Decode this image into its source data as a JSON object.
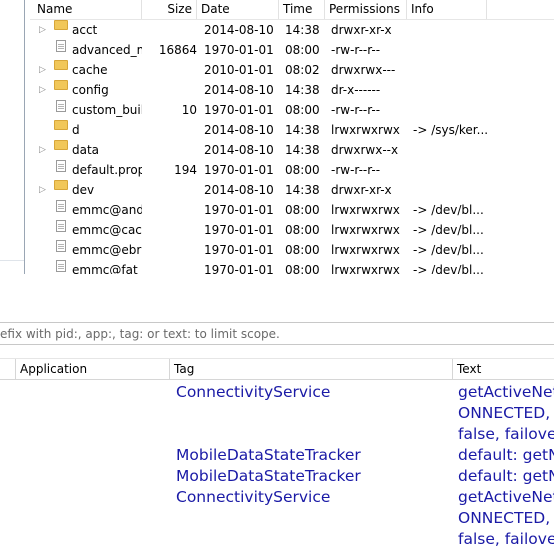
{
  "file_table": {
    "columns": [
      "Name",
      "Size",
      "Date",
      "Time",
      "Permissions",
      "Info"
    ],
    "rows": [
      {
        "name": "acct",
        "type": "folder",
        "expandable": true,
        "size": "",
        "date": "2014-08-10",
        "time": "14:38",
        "permissions": "drwxr-xr-x",
        "info": ""
      },
      {
        "name": "advanced_m",
        "type": "file",
        "expandable": false,
        "size": "16864",
        "date": "1970-01-01",
        "time": "08:00",
        "permissions": "-rw-r--r--",
        "info": ""
      },
      {
        "name": "cache",
        "type": "folder",
        "expandable": true,
        "size": "",
        "date": "2010-01-01",
        "time": "08:02",
        "permissions": "drwxrwx---",
        "info": ""
      },
      {
        "name": "config",
        "type": "folder",
        "expandable": true,
        "size": "",
        "date": "2014-08-10",
        "time": "14:38",
        "permissions": "dr-x------",
        "info": ""
      },
      {
        "name": "custom_buil",
        "type": "file",
        "expandable": false,
        "size": "10",
        "date": "1970-01-01",
        "time": "08:00",
        "permissions": "-rw-r--r--",
        "info": ""
      },
      {
        "name": "d",
        "type": "folder",
        "expandable": false,
        "size": "",
        "date": "2014-08-10",
        "time": "14:38",
        "permissions": "lrwxrwxrwx",
        "info": "-> /sys/ker..."
      },
      {
        "name": "data",
        "type": "folder",
        "expandable": true,
        "size": "",
        "date": "2014-08-10",
        "time": "14:38",
        "permissions": "drwxrwx--x",
        "info": ""
      },
      {
        "name": "default.prop",
        "type": "file",
        "expandable": false,
        "size": "194",
        "date": "1970-01-01",
        "time": "08:00",
        "permissions": "-rw-r--r--",
        "info": ""
      },
      {
        "name": "dev",
        "type": "folder",
        "expandable": true,
        "size": "",
        "date": "2014-08-10",
        "time": "14:38",
        "permissions": "drwxr-xr-x",
        "info": ""
      },
      {
        "name": "emmc@and",
        "type": "file",
        "expandable": false,
        "size": "",
        "date": "1970-01-01",
        "time": "08:00",
        "permissions": "lrwxrwxrwx",
        "info": "-> /dev/bl..."
      },
      {
        "name": "emmc@cacl",
        "type": "file",
        "expandable": false,
        "size": "",
        "date": "1970-01-01",
        "time": "08:00",
        "permissions": "lrwxrwxrwx",
        "info": "-> /dev/bl..."
      },
      {
        "name": "emmc@ebr",
        "type": "file",
        "expandable": false,
        "size": "",
        "date": "1970-01-01",
        "time": "08:00",
        "permissions": "lrwxrwxrwx",
        "info": "-> /dev/bl..."
      },
      {
        "name": "emmc@fat",
        "type": "file",
        "expandable": false,
        "size": "",
        "date": "1970-01-01",
        "time": "08:00",
        "permissions": "lrwxrwxrwx",
        "info": "-> /dev/bl..."
      }
    ]
  },
  "logcat": {
    "filter_hint": "efix with pid:, app:, tag: or text: to limit scope.",
    "columns": [
      "Application",
      "Tag",
      "Text"
    ],
    "lines": [
      {
        "tag": "ConnectivityService",
        "text": "getActiveNet"
      },
      {
        "tag": "",
        "text": "ONNECTED,"
      },
      {
        "tag": "",
        "text": " false, failove"
      },
      {
        "tag": "MobileDataStateTracker",
        "text": "default: getN"
      },
      {
        "tag": "MobileDataStateTracker",
        "text": "default: getN"
      },
      {
        "tag": "ConnectivityService",
        "text": "getActiveNet"
      },
      {
        "tag": "",
        "text": "ONNECTED,"
      },
      {
        "tag": "",
        "text": " false, failove"
      }
    ],
    "text_color": "#1a1aa6"
  }
}
